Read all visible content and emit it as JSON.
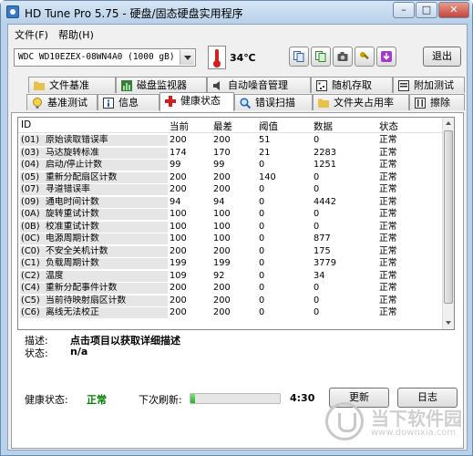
{
  "window": {
    "title": "HD Tune Pro 5.75 - 硬盘/固态硬盘实用程序",
    "minimize_label": "–",
    "maximize_label": "□",
    "close_label": "✕"
  },
  "menu": {
    "file": "文件(F)",
    "help": "帮助(H)"
  },
  "toolbar": {
    "drive": "WDC WD10EZEX-08WN4A0 (1000 gB)",
    "temperature": "34℃",
    "exit_label": "退出",
    "icons": [
      "copy-text-icon",
      "copy-screen-icon",
      "camera-icon",
      "tools-icon",
      "download-icon"
    ]
  },
  "tabs": {
    "row1": [
      {
        "label": "文件基准",
        "icon": "folder-benchmark-icon"
      },
      {
        "label": "磁盘监视器",
        "icon": "disk-monitor-icon"
      },
      {
        "label": "自动噪音管理",
        "icon": "speaker-icon"
      },
      {
        "label": "随机存取",
        "icon": "random-access-icon"
      },
      {
        "label": "附加测试",
        "icon": "extra-tests-icon"
      }
    ],
    "row2": [
      {
        "label": "基准测试",
        "icon": "benchmark-icon"
      },
      {
        "label": "信息",
        "icon": "info-icon"
      },
      {
        "label": "健康状态",
        "icon": "health-cross-icon"
      },
      {
        "label": "错误扫描",
        "icon": "error-scan-icon"
      },
      {
        "label": "文件夹占用率",
        "icon": "folder-usage-icon"
      },
      {
        "label": "擦除",
        "icon": "erase-icon"
      }
    ]
  },
  "health": {
    "columns": [
      "ID",
      "当前",
      "最差",
      "阈值",
      "数据",
      "状态"
    ],
    "rows": [
      {
        "id": "(01)",
        "name": "原始读取错误率",
        "cur": "200",
        "worst": "200",
        "thr": "51",
        "data": "0",
        "status": "正常"
      },
      {
        "id": "(03)",
        "name": "马达旋转标准",
        "cur": "174",
        "worst": "170",
        "thr": "21",
        "data": "2283",
        "status": "正常"
      },
      {
        "id": "(04)",
        "name": "启动/停止计数",
        "cur": "99",
        "worst": "99",
        "thr": "0",
        "data": "1251",
        "status": "正常"
      },
      {
        "id": "(05)",
        "name": "重新分配扇区计数",
        "cur": "200",
        "worst": "200",
        "thr": "140",
        "data": "0",
        "status": "正常"
      },
      {
        "id": "(07)",
        "name": "寻道错误率",
        "cur": "200",
        "worst": "200",
        "thr": "0",
        "data": "0",
        "status": "正常"
      },
      {
        "id": "(09)",
        "name": "通电时间计数",
        "cur": "94",
        "worst": "94",
        "thr": "0",
        "data": "4442",
        "status": "正常"
      },
      {
        "id": "(0A)",
        "name": "旋转重试计数",
        "cur": "100",
        "worst": "100",
        "thr": "0",
        "data": "0",
        "status": "正常"
      },
      {
        "id": "(0B)",
        "name": "校准重试计数",
        "cur": "100",
        "worst": "100",
        "thr": "0",
        "data": "0",
        "status": "正常"
      },
      {
        "id": "(0C)",
        "name": "电源周期计数",
        "cur": "100",
        "worst": "100",
        "thr": "0",
        "data": "877",
        "status": "正常"
      },
      {
        "id": "(C0)",
        "name": "不安全关机计数",
        "cur": "200",
        "worst": "200",
        "thr": "0",
        "data": "175",
        "status": "正常"
      },
      {
        "id": "(C1)",
        "name": "负载周期计数",
        "cur": "199",
        "worst": "199",
        "thr": "0",
        "data": "3779",
        "status": "正常"
      },
      {
        "id": "(C2)",
        "name": "温度",
        "cur": "109",
        "worst": "92",
        "thr": "0",
        "data": "34",
        "status": "正常"
      },
      {
        "id": "(C4)",
        "name": "重新分配事件计数",
        "cur": "200",
        "worst": "200",
        "thr": "0",
        "data": "0",
        "status": "正常"
      },
      {
        "id": "(C5)",
        "name": "当前待映射扇区计数",
        "cur": "200",
        "worst": "200",
        "thr": "0",
        "data": "0",
        "status": "正常"
      },
      {
        "id": "(C6)",
        "name": "离线无法校正",
        "cur": "200",
        "worst": "200",
        "thr": "0",
        "data": "0",
        "status": "正常"
      }
    ],
    "desc_label": "描述:",
    "desc_value": "点击项目以获取详细描述",
    "state_label": "状态:",
    "state_value": "n/a",
    "health_label": "健康状态:",
    "health_value": "正常",
    "refresh_label": "下次刷新:",
    "refresh_progress": 0.05,
    "refresh_timer": "4:30",
    "update_button": "更新",
    "log_button": "日志"
  },
  "watermark": {
    "title": "当下软件园",
    "url": "www.downxia.com"
  }
}
